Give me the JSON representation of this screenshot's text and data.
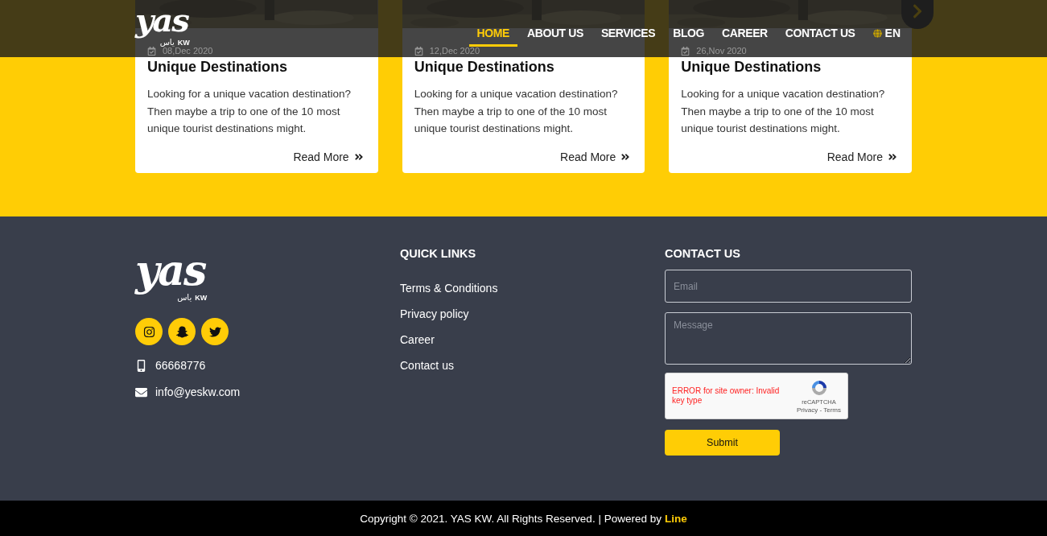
{
  "header": {
    "logo": {
      "mark": "yas",
      "arabic": "ياس",
      "suffix": "KW"
    },
    "nav": [
      {
        "label": "HOME",
        "selected": true
      },
      {
        "label": "ABOUT US",
        "selected": false
      },
      {
        "label": "SERVICES",
        "selected": false
      },
      {
        "label": "BLOG",
        "selected": false
      },
      {
        "label": "CAREER",
        "selected": false
      },
      {
        "label": "CONTACT US",
        "selected": false
      }
    ],
    "language": {
      "label": "EN",
      "selected": false
    }
  },
  "cards": [
    {
      "date": "08,Dec 2020",
      "title": "Unique Destinations",
      "text": "Looking for a unique vacation destination? Then maybe a trip to one of the 10 most unique tourist destinations might.",
      "link": "Read More"
    },
    {
      "date": "12,Dec 2020",
      "title": "Unique Destinations",
      "text": "Looking for a unique vacation destination? Then maybe a trip to one of the 10 most unique tourist destinations might.",
      "link": "Read More"
    },
    {
      "date": "26,Nov 2020",
      "title": "Unique Destinations",
      "text": "Looking for a unique vacation destination? Then maybe a trip to one of the 10 most unique tourist destinations might.",
      "link": "Read More"
    }
  ],
  "footer": {
    "logo": {
      "mark": "yas",
      "arabic": "ياس",
      "suffix": "KW"
    },
    "phone": "66668776",
    "email": "info@yeskw.com",
    "quick_links": {
      "title": "QUICK LINKS",
      "links": [
        "Terms & Conditions",
        "Privacy policy",
        "Career",
        "Contact us"
      ]
    },
    "contact": {
      "title": "CONTACT US",
      "email_placeholder": "Email",
      "message_placeholder": "Message",
      "captcha": {
        "error": "ERROR for site owner: Invalid key type",
        "brand": "reCAPTCHA",
        "links": "Privacy - Terms"
      },
      "submit": "Submit"
    }
  },
  "copyright": {
    "text": "Copyright © 2021. YAS KW. All Rights Reserved. | Powered by",
    "link": "Line"
  }
}
